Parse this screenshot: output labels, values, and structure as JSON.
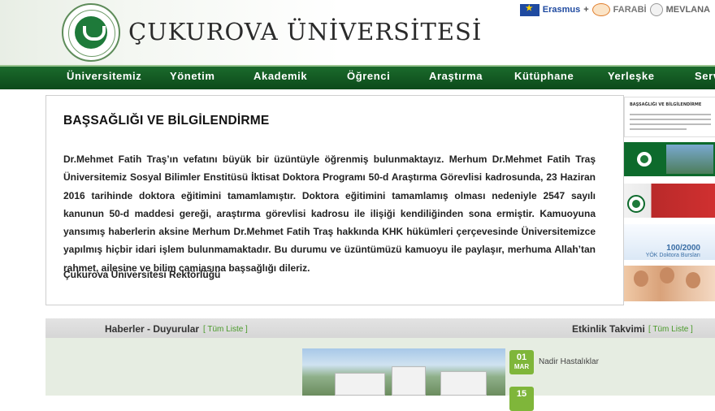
{
  "header": {
    "title": "ÇUKUROVA ÜNİVERSİTESİ",
    "logo_icon": "university-seal-icon",
    "partners": {
      "erasmus": "Erasmus",
      "plus": "+",
      "farabi": "FARABİ",
      "mevlana": "MEVLANA"
    }
  },
  "nav": {
    "items": [
      "Üniversitemiz",
      "Yönetim",
      "Akademik",
      "Öğrenci",
      "Araştırma",
      "Kütüphane",
      "Yerleşke",
      "Serv"
    ]
  },
  "article": {
    "title": "BAŞSAĞLIĞI VE BİLGİLENDİRME",
    "body": "Dr.Mehmet Fatih Traş’ın vefatını büyük bir üzüntüyle öğrenmiş bulunmaktayız. Merhum Dr.Mehmet Fatih Traş Üniversitemiz Sosyal Bilimler Enstitüsü İktisat Doktora Programı 50-d Araştırma Görevlisi kadrosunda, 23 Haziran 2016 tarihinde doktora eğitimini tamamlamıştır. Doktora eğitimini tamamlamış olması nedeniyle 2547 sayılı kanunun 50-d maddesi gereği, araştırma görevlisi kadrosu ile ilişiği kendiliğinden sona ermiştir. Kamuoyuna yansımış haberlerin aksine Merhum Dr.Mehmet Fatih Traş hakkında KHK hükümleri çerçevesinde Üniversitemizce yapılmış hiçbir idari işlem bulunmamaktadır. Bu durumu ve üzüntümüzü kamuoyu ile paylaşır, merhuma Allah’tan rahmet, ailesine ve bilim camiasına başsağlığı dileriz.",
    "signature": "Çukurova Üniversitesi Rektörlüğü"
  },
  "sidebar": {
    "doc_title": "BAŞSAĞLIĞI VE BİLGİLENDİRME",
    "burs_number": "100/2000",
    "burs_text": "YÖK Doktora Bursları"
  },
  "news": {
    "title": "Haberler - Duyurular",
    "list_link": "[ Tüm Liste ]"
  },
  "events": {
    "title": "Etkinlik Takvimi",
    "list_link": "[ Tüm Liste ]",
    "items": [
      {
        "day": "01",
        "month": "MAR",
        "title": "Nadir Hastalıklar"
      },
      {
        "day": "15",
        "month": "",
        "title": ""
      }
    ]
  },
  "colors": {
    "nav_green": "#0c4a1a",
    "accent_green": "#4a9a2a",
    "event_badge": "#7fb63a"
  }
}
